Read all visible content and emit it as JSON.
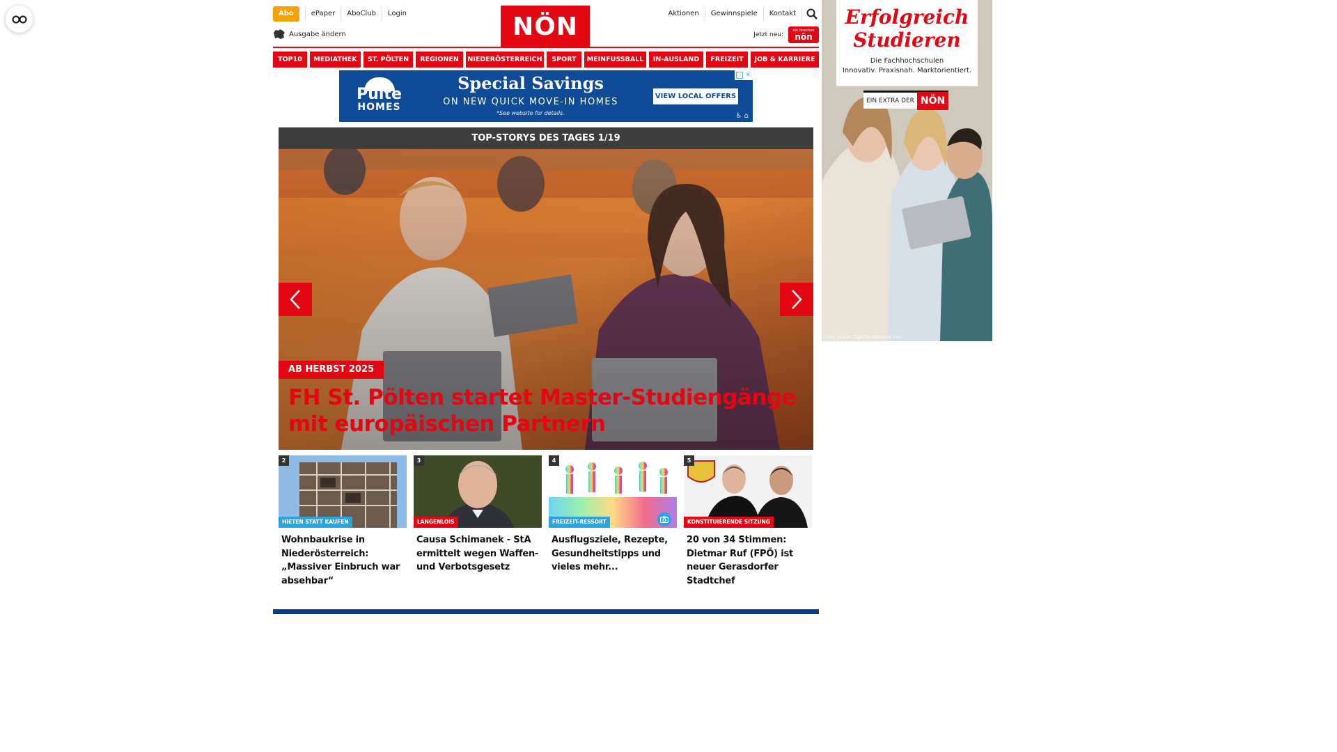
{
  "header": {
    "abo": "Abo",
    "top_links": [
      "ePaper",
      "AboClub",
      "Login"
    ],
    "ausgabe": "Ausgabe ändern",
    "logo": "NÖN",
    "right_links": [
      "Aktionen",
      "Gewinnspiele",
      "Kontakt"
    ],
    "jetzt_neu": "Jetzt neu:",
    "jetzt_badge_small": "ein bisschen",
    "jetzt_badge": "nön"
  },
  "nav": [
    "TOP10",
    "MEDIATHEK",
    "ST. PÖLTEN",
    "REGIONEN",
    "NIEDERÖSTERREICH",
    "SPORT",
    "MEINFUSSBALL",
    "IN-AUSLAND",
    "FREIZEIT",
    "JOB & KARRIERE"
  ],
  "ad_banner": {
    "brand_top": "Pulte",
    "brand_bottom": "HOMES",
    "headline": "Special Savings",
    "subline": "ON NEW QUICK MOVE-IN HOMES",
    "note": "*See website for details.",
    "cta": "VIEW LOCAL OFFERS"
  },
  "top_stories": {
    "header": "TOP-STORYS DES TAGES 1/19",
    "hero": {
      "kicker": "AB HERBST 2025",
      "title": "FH St. Pölten startet Master-Studiengänge mit europäischen Partnern"
    },
    "cards": [
      {
        "num": "2",
        "tag": "HIETEN STATT KAUFEN",
        "title": "Wohnbaukrise in Niederösterreich: „Massiver Einbruch war absehbar“"
      },
      {
        "num": "3",
        "tag": "LANGENLOIS",
        "title": "Causa Schimanek - StA ermittelt wegen Waffen- und Verbotsgesetz"
      },
      {
        "num": "4",
        "tag": "FREIZEIT-RESSORT",
        "title": "Ausflugsziele, Rezepte, Gesundheitstipps und vieles mehr..."
      },
      {
        "num": "5",
        "tag": "KONSTITUIERENDE SITZUNG",
        "title": "20 von 34 Stimmen: Dietmar Ruf (FPÖ) ist neuer Gerasdorfer Stadtchef"
      }
    ]
  },
  "side_ad": {
    "title_line1": "Erfolgreich",
    "title_line2": "Studieren",
    "sub1": "Die Fachhochschulen",
    "sub2": "Innovativ. Praxisnah. Marktorientiert.",
    "extra_text": "EIN EXTRA DER",
    "extra_brand": "NÖN",
    "credit": "Foto: Drazen Zigic/Shutterstock.com"
  },
  "colors": {
    "brand_red": "#e30613",
    "abo_orange": "#f5a300",
    "tag_blue": "#2aa4df",
    "ad_blue": "#0f4b96",
    "footer_blue": "#0d3a8a"
  }
}
